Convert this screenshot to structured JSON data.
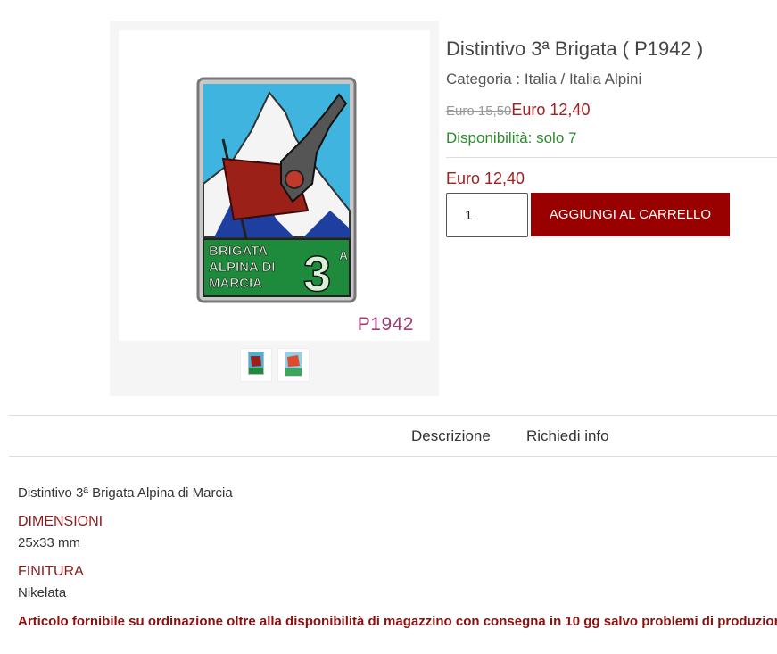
{
  "product": {
    "title": "Distintivo 3ª Brigata ( P1942 )",
    "category": "Categoria : Italia / Italia Alpini",
    "old_price": "Euro 15,50",
    "new_price": "Euro 12,40",
    "availability": "Disponibilità: solo 7",
    "price_final": "Euro 12,40",
    "quantity": "1",
    "add_to_cart_label": "AGGIUNGI AL CARRELLO"
  },
  "image": {
    "badge_text_line1": "BRIGATA",
    "badge_text_line2": "ALPINA DI",
    "badge_text_line3": "MARCIA",
    "badge_number": "3",
    "badge_superscript": "A",
    "sku_mark": "P1942"
  },
  "tabs": [
    {
      "label": "Descrizione"
    },
    {
      "label": "Richiedi info"
    }
  ],
  "description": {
    "intro": "Distintivo 3ª Brigata Alpina di Marcia",
    "dimensions_label": "DIMENSIONI",
    "dimensions_value": "25x33 mm",
    "finish_label": "FINITURA",
    "finish_value": "Nikelata",
    "notice": "Articolo fornibile su ordinazione oltre alla disponibilità di magazzino con consegna in 10 gg salvo problemi di produzione."
  },
  "colors": {
    "accent": "#990000",
    "price": "#a02020",
    "availability": "#2e8b2e",
    "sku": "#a03c73"
  }
}
